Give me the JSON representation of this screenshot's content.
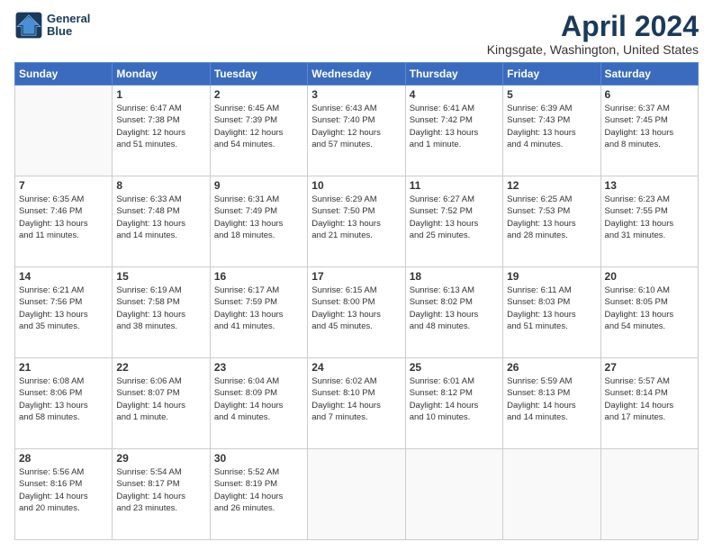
{
  "logo": {
    "line1": "General",
    "line2": "Blue"
  },
  "title": "April 2024",
  "subtitle": "Kingsgate, Washington, United States",
  "weekdays": [
    "Sunday",
    "Monday",
    "Tuesday",
    "Wednesday",
    "Thursday",
    "Friday",
    "Saturday"
  ],
  "weeks": [
    [
      {
        "day": "",
        "info": ""
      },
      {
        "day": "1",
        "info": "Sunrise: 6:47 AM\nSunset: 7:38 PM\nDaylight: 12 hours\nand 51 minutes."
      },
      {
        "day": "2",
        "info": "Sunrise: 6:45 AM\nSunset: 7:39 PM\nDaylight: 12 hours\nand 54 minutes."
      },
      {
        "day": "3",
        "info": "Sunrise: 6:43 AM\nSunset: 7:40 PM\nDaylight: 12 hours\nand 57 minutes."
      },
      {
        "day": "4",
        "info": "Sunrise: 6:41 AM\nSunset: 7:42 PM\nDaylight: 13 hours\nand 1 minute."
      },
      {
        "day": "5",
        "info": "Sunrise: 6:39 AM\nSunset: 7:43 PM\nDaylight: 13 hours\nand 4 minutes."
      },
      {
        "day": "6",
        "info": "Sunrise: 6:37 AM\nSunset: 7:45 PM\nDaylight: 13 hours\nand 8 minutes."
      }
    ],
    [
      {
        "day": "7",
        "info": "Sunrise: 6:35 AM\nSunset: 7:46 PM\nDaylight: 13 hours\nand 11 minutes."
      },
      {
        "day": "8",
        "info": "Sunrise: 6:33 AM\nSunset: 7:48 PM\nDaylight: 13 hours\nand 14 minutes."
      },
      {
        "day": "9",
        "info": "Sunrise: 6:31 AM\nSunset: 7:49 PM\nDaylight: 13 hours\nand 18 minutes."
      },
      {
        "day": "10",
        "info": "Sunrise: 6:29 AM\nSunset: 7:50 PM\nDaylight: 13 hours\nand 21 minutes."
      },
      {
        "day": "11",
        "info": "Sunrise: 6:27 AM\nSunset: 7:52 PM\nDaylight: 13 hours\nand 25 minutes."
      },
      {
        "day": "12",
        "info": "Sunrise: 6:25 AM\nSunset: 7:53 PM\nDaylight: 13 hours\nand 28 minutes."
      },
      {
        "day": "13",
        "info": "Sunrise: 6:23 AM\nSunset: 7:55 PM\nDaylight: 13 hours\nand 31 minutes."
      }
    ],
    [
      {
        "day": "14",
        "info": "Sunrise: 6:21 AM\nSunset: 7:56 PM\nDaylight: 13 hours\nand 35 minutes."
      },
      {
        "day": "15",
        "info": "Sunrise: 6:19 AM\nSunset: 7:58 PM\nDaylight: 13 hours\nand 38 minutes."
      },
      {
        "day": "16",
        "info": "Sunrise: 6:17 AM\nSunset: 7:59 PM\nDaylight: 13 hours\nand 41 minutes."
      },
      {
        "day": "17",
        "info": "Sunrise: 6:15 AM\nSunset: 8:00 PM\nDaylight: 13 hours\nand 45 minutes."
      },
      {
        "day": "18",
        "info": "Sunrise: 6:13 AM\nSunset: 8:02 PM\nDaylight: 13 hours\nand 48 minutes."
      },
      {
        "day": "19",
        "info": "Sunrise: 6:11 AM\nSunset: 8:03 PM\nDaylight: 13 hours\nand 51 minutes."
      },
      {
        "day": "20",
        "info": "Sunrise: 6:10 AM\nSunset: 8:05 PM\nDaylight: 13 hours\nand 54 minutes."
      }
    ],
    [
      {
        "day": "21",
        "info": "Sunrise: 6:08 AM\nSunset: 8:06 PM\nDaylight: 13 hours\nand 58 minutes."
      },
      {
        "day": "22",
        "info": "Sunrise: 6:06 AM\nSunset: 8:07 PM\nDaylight: 14 hours\nand 1 minute."
      },
      {
        "day": "23",
        "info": "Sunrise: 6:04 AM\nSunset: 8:09 PM\nDaylight: 14 hours\nand 4 minutes."
      },
      {
        "day": "24",
        "info": "Sunrise: 6:02 AM\nSunset: 8:10 PM\nDaylight: 14 hours\nand 7 minutes."
      },
      {
        "day": "25",
        "info": "Sunrise: 6:01 AM\nSunset: 8:12 PM\nDaylight: 14 hours\nand 10 minutes."
      },
      {
        "day": "26",
        "info": "Sunrise: 5:59 AM\nSunset: 8:13 PM\nDaylight: 14 hours\nand 14 minutes."
      },
      {
        "day": "27",
        "info": "Sunrise: 5:57 AM\nSunset: 8:14 PM\nDaylight: 14 hours\nand 17 minutes."
      }
    ],
    [
      {
        "day": "28",
        "info": "Sunrise: 5:56 AM\nSunset: 8:16 PM\nDaylight: 14 hours\nand 20 minutes."
      },
      {
        "day": "29",
        "info": "Sunrise: 5:54 AM\nSunset: 8:17 PM\nDaylight: 14 hours\nand 23 minutes."
      },
      {
        "day": "30",
        "info": "Sunrise: 5:52 AM\nSunset: 8:19 PM\nDaylight: 14 hours\nand 26 minutes."
      },
      {
        "day": "",
        "info": ""
      },
      {
        "day": "",
        "info": ""
      },
      {
        "day": "",
        "info": ""
      },
      {
        "day": "",
        "info": ""
      }
    ]
  ]
}
